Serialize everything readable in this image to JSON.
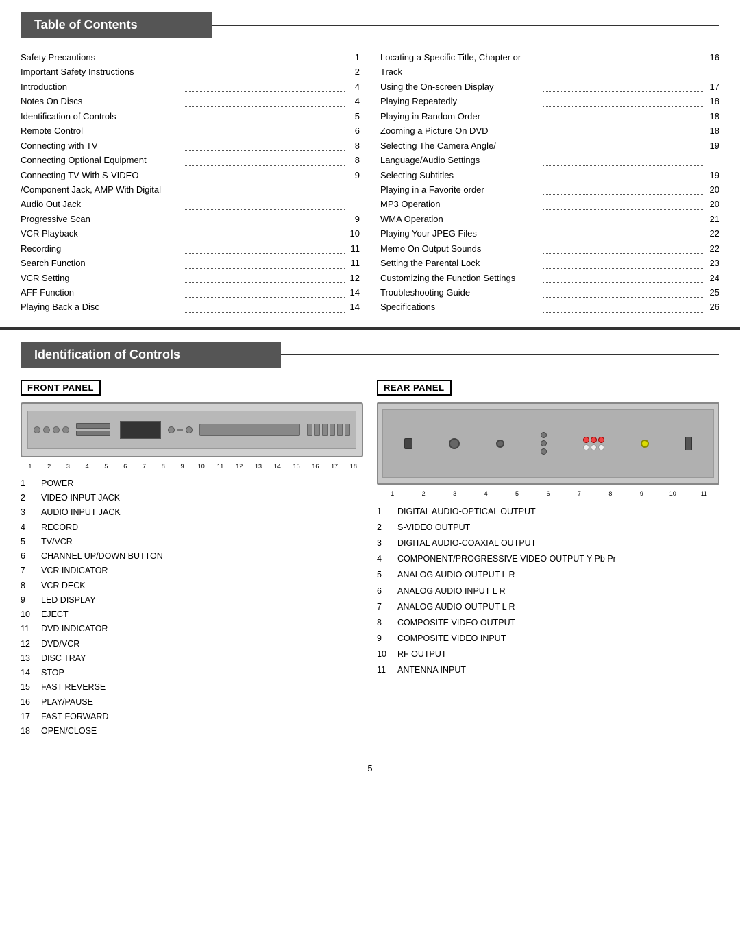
{
  "toc": {
    "title": "Table of Contents",
    "left_entries": [
      {
        "text": "Safety Precautions",
        "dots": true,
        "page": "1"
      },
      {
        "text": "Important Safety Instructions",
        "dots": true,
        "page": "2"
      },
      {
        "text": "Introduction",
        "dots": true,
        "page": "4"
      },
      {
        "text": "Notes On Discs",
        "dots": true,
        "page": "4"
      },
      {
        "text": "Identification of Controls",
        "dots": true,
        "page": "5"
      },
      {
        "text": "Remote Control",
        "dots": true,
        "page": "6"
      },
      {
        "text": "Connecting with TV",
        "dots": true,
        "page": "8"
      },
      {
        "text": "Connecting Optional Equipment",
        "dots": true,
        "page": "8"
      },
      {
        "text": "Connecting TV With S-VIDEO /Component Jack, AMP With Digital Audio Out Jack",
        "dots": true,
        "page": "9"
      },
      {
        "text": "Progressive Scan",
        "dots": true,
        "page": "9"
      },
      {
        "text": "VCR Playback",
        "dots": true,
        "page": "10"
      },
      {
        "text": "Recording",
        "dots": true,
        "page": "11"
      },
      {
        "text": "Search Function",
        "dots": true,
        "page": "11"
      },
      {
        "text": "VCR Setting",
        "dots": true,
        "page": "12"
      },
      {
        "text": "AFF Function",
        "dots": true,
        "page": "14"
      },
      {
        "text": "Playing Back a Disc",
        "dots": true,
        "page": "14"
      }
    ],
    "right_entries": [
      {
        "text": "Locating a Specific Title, Chapter or Track",
        "dots": true,
        "page": "16"
      },
      {
        "text": "Using the On-screen Display",
        "dots": true,
        "page": "17"
      },
      {
        "text": "Playing Repeatedly",
        "dots": true,
        "page": "18"
      },
      {
        "text": "Playing in Random Order",
        "dots": true,
        "page": "18"
      },
      {
        "text": "Zooming a Picture On DVD",
        "dots": true,
        "page": "18"
      },
      {
        "text": "Selecting The Camera Angle/ Language/Audio Settings",
        "dots": true,
        "page": "19"
      },
      {
        "text": "Selecting Subtitles",
        "dots": true,
        "page": "19"
      },
      {
        "text": "Playing in a Favorite order",
        "dots": true,
        "page": "20"
      },
      {
        "text": "MP3 Operation",
        "dots": true,
        "page": "20"
      },
      {
        "text": "WMA Operation",
        "dots": true,
        "page": "21"
      },
      {
        "text": "Playing Your JPEG Files",
        "dots": true,
        "page": "22"
      },
      {
        "text": "Memo On Output Sounds",
        "dots": true,
        "page": "22"
      },
      {
        "text": "Setting the Parental Lock",
        "dots": true,
        "page": "23"
      },
      {
        "text": "Customizing the Function Settings",
        "dots": true,
        "page": "24"
      },
      {
        "text": "Troubleshooting Guide",
        "dots": true,
        "page": "25"
      },
      {
        "text": "Specifications",
        "dots": true,
        "page": "26"
      }
    ]
  },
  "ioc": {
    "title": "Identification of Controls",
    "front_panel": {
      "label": "FRONT PANEL",
      "numbers": [
        "1",
        "2",
        "3",
        "4",
        "5",
        "6",
        "7",
        "8",
        "9",
        "10",
        "11",
        "12",
        "13",
        "14",
        "15",
        "16",
        "17",
        "18"
      ],
      "items": [
        {
          "num": "1",
          "text": "POWER"
        },
        {
          "num": "2",
          "text": "VIDEO INPUT JACK"
        },
        {
          "num": "3",
          "text": "AUDIO INPUT JACK"
        },
        {
          "num": "4",
          "text": "RECORD"
        },
        {
          "num": "5",
          "text": "TV/VCR"
        },
        {
          "num": "6",
          "text": "CHANNEL UP/DOWN BUTTON"
        },
        {
          "num": "7",
          "text": "VCR INDICATOR"
        },
        {
          "num": "8",
          "text": "VCR DECK"
        },
        {
          "num": "9",
          "text": "LED DISPLAY"
        },
        {
          "num": "10",
          "text": "EJECT"
        },
        {
          "num": "11",
          "text": "DVD INDICATOR"
        },
        {
          "num": "12",
          "text": "DVD/VCR"
        },
        {
          "num": "13",
          "text": "DISC TRAY"
        },
        {
          "num": "14",
          "text": "STOP"
        },
        {
          "num": "15",
          "text": "FAST REVERSE"
        },
        {
          "num": "16",
          "text": "PLAY/PAUSE"
        },
        {
          "num": "17",
          "text": "FAST FORWARD"
        },
        {
          "num": "18",
          "text": "OPEN/CLOSE"
        }
      ]
    },
    "rear_panel": {
      "label": "REAR  PANEL",
      "numbers": [
        "1",
        "2",
        "3",
        "4",
        "5",
        "6",
        "7",
        "8",
        "9",
        "10",
        "11"
      ],
      "items": [
        {
          "num": "1",
          "text": "DIGITAL AUDIO-OPTICAL OUTPUT"
        },
        {
          "num": "2",
          "text": "S-VIDEO OUTPUT"
        },
        {
          "num": "3",
          "text": "DIGITAL AUDIO-COAXIAL OUTPUT"
        },
        {
          "num": "4",
          "text": "COMPONENT/PROGRESSIVE VIDEO OUTPUT Y Pb Pr"
        },
        {
          "num": "5",
          "text": "ANALOG AUDIO OUTPUT L R"
        },
        {
          "num": "6",
          "text": "ANALOG AUDIO INPUT L R"
        },
        {
          "num": "7",
          "text": "ANALOG AUDIO OUTPUT L R"
        },
        {
          "num": "8",
          "text": "COMPOSITE VIDEO OUTPUT"
        },
        {
          "num": "9",
          "text": "COMPOSITE VIDEO INPUT"
        },
        {
          "num": "10",
          "text": "RF OUTPUT"
        },
        {
          "num": "11",
          "text": "ANTENNA INPUT"
        }
      ]
    }
  },
  "page_number": "5"
}
